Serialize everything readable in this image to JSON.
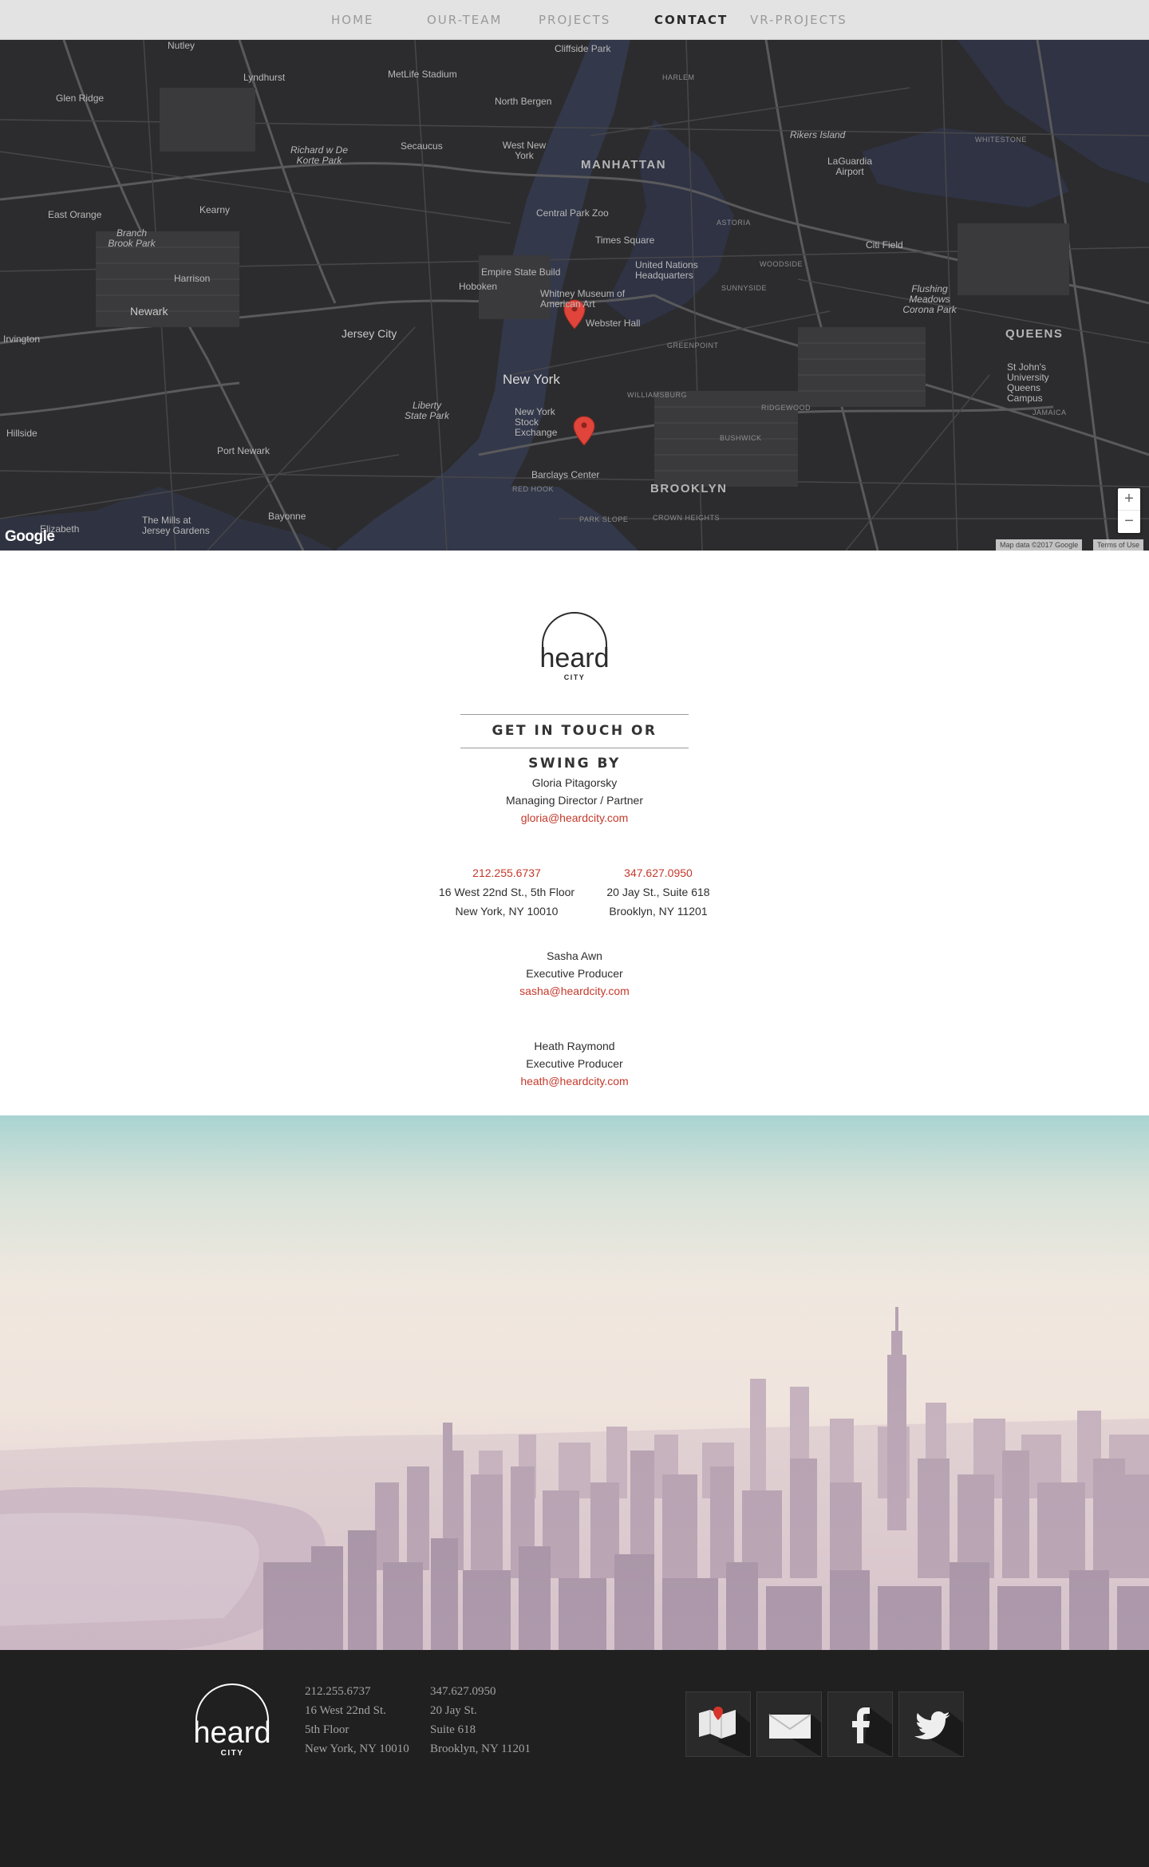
{
  "nav": {
    "items": [
      {
        "label": "HOME"
      },
      {
        "label": "OUR-TEAM"
      },
      {
        "label": "PROJECTS"
      },
      {
        "label": "CONTACT",
        "active": true
      },
      {
        "label": "VR-PROJECTS"
      }
    ]
  },
  "map": {
    "labels": {
      "nutley": "Nutley",
      "lyndhurst": "Lyndhurst",
      "metlife": "MetLife Stadium",
      "cliffside": "Cliffside Park",
      "glenridge": "Glen Ridge",
      "northbergen": "North Bergen",
      "secaucus": "Secaucus",
      "westny": "West New York",
      "richard": "Richard w De Korte Park",
      "manhattan": "MANHATTAN",
      "rikers": "Rikers Island",
      "laguardia": "LaGuardia Airport",
      "eastorange": "East Orange",
      "kearny": "Kearny",
      "branch": "Branch Brook Park",
      "centralpark": "Central Park Zoo",
      "timessq": "Times Square",
      "un": "United Nations Headquarters",
      "citifield": "Citi Field",
      "harrison": "Harrison",
      "empire": "Empire State Build",
      "hoboken": "Hoboken",
      "whitney": "Whitney Museum of American Art",
      "flushing": "Flushing Meadows Corona Park",
      "newark": "Newark",
      "jerseycity": "Jersey City",
      "webster": "Webster Hall",
      "queens": "QUEENS",
      "irvington": "Irvington",
      "newyork": "New York",
      "liberty": "Liberty State Park",
      "nyse": "New York Stock Exchange",
      "stjohns": "St John's University Queens Campus",
      "hillside": "Hillside",
      "portnewark": "Port Newark",
      "barclays": "Barclays Center",
      "brooklyn": "BROOKLYN",
      "elizabeth": "Elizabeth",
      "mills": "The Mills at Jersey Gardens",
      "bayonne": "Bayonne",
      "harlem": "HARLEM",
      "astoria": "ASTORIA",
      "woodside": "WOODSIDE",
      "sunnyside": "SUNNYSIDE",
      "greenpoint": "GREENPOINT",
      "williamsburg": "WILLIAMSBURG",
      "bushwick": "BUSHWICK",
      "ridgewood": "RIDGEWOOD",
      "crownheights": "CROWN HEIGHTS",
      "parkslope": "PARK SLOPE",
      "redhook": "RED HOOK",
      "jamaica": "JAMAICA",
      "whitestone": "WHITESTONE"
    },
    "google": "Google",
    "attribution": "Map data ©2017 Google",
    "terms": "Terms of Use",
    "zoom_in": "+",
    "zoom_out": "−"
  },
  "logo": {
    "word": "heard",
    "sub": "CITY"
  },
  "heading": "GET IN TOUCH OR SWING BY",
  "contacts": [
    {
      "name": "Gloria Pitagorsky",
      "title": "Managing Director / Partner",
      "email": "gloria@heardcity.com"
    },
    {
      "name": "Sasha Awn",
      "title": "Executive Producer",
      "email": "sasha@heardcity.com"
    },
    {
      "name": "Heath Raymond",
      "title": "Executive Producer",
      "email": "heath@heardcity.com"
    }
  ],
  "offices": [
    {
      "phone": "212.255.6737",
      "street": "16 West 22nd St., 5th Floor",
      "city": "New York, NY 10010"
    },
    {
      "phone": "347.627.0950",
      "street": "20 Jay St., Suite 618",
      "city": "Brooklyn, NY 11201"
    }
  ],
  "footer": {
    "col1": [
      "212.255.6737",
      "16 West 22nd St.",
      "5th Floor",
      "New York, NY 10010"
    ],
    "col2": [
      "347.627.0950",
      "20 Jay St.",
      "Suite 618",
      "Brooklyn, NY 11201"
    ],
    "social": [
      "map-icon",
      "mail-icon",
      "facebook-icon",
      "twitter-icon"
    ]
  },
  "colors": {
    "accent": "#c4392b",
    "nav_bg": "#e3e3e3",
    "footer_bg": "#202020",
    "map_bg": "#2c2c2e"
  }
}
